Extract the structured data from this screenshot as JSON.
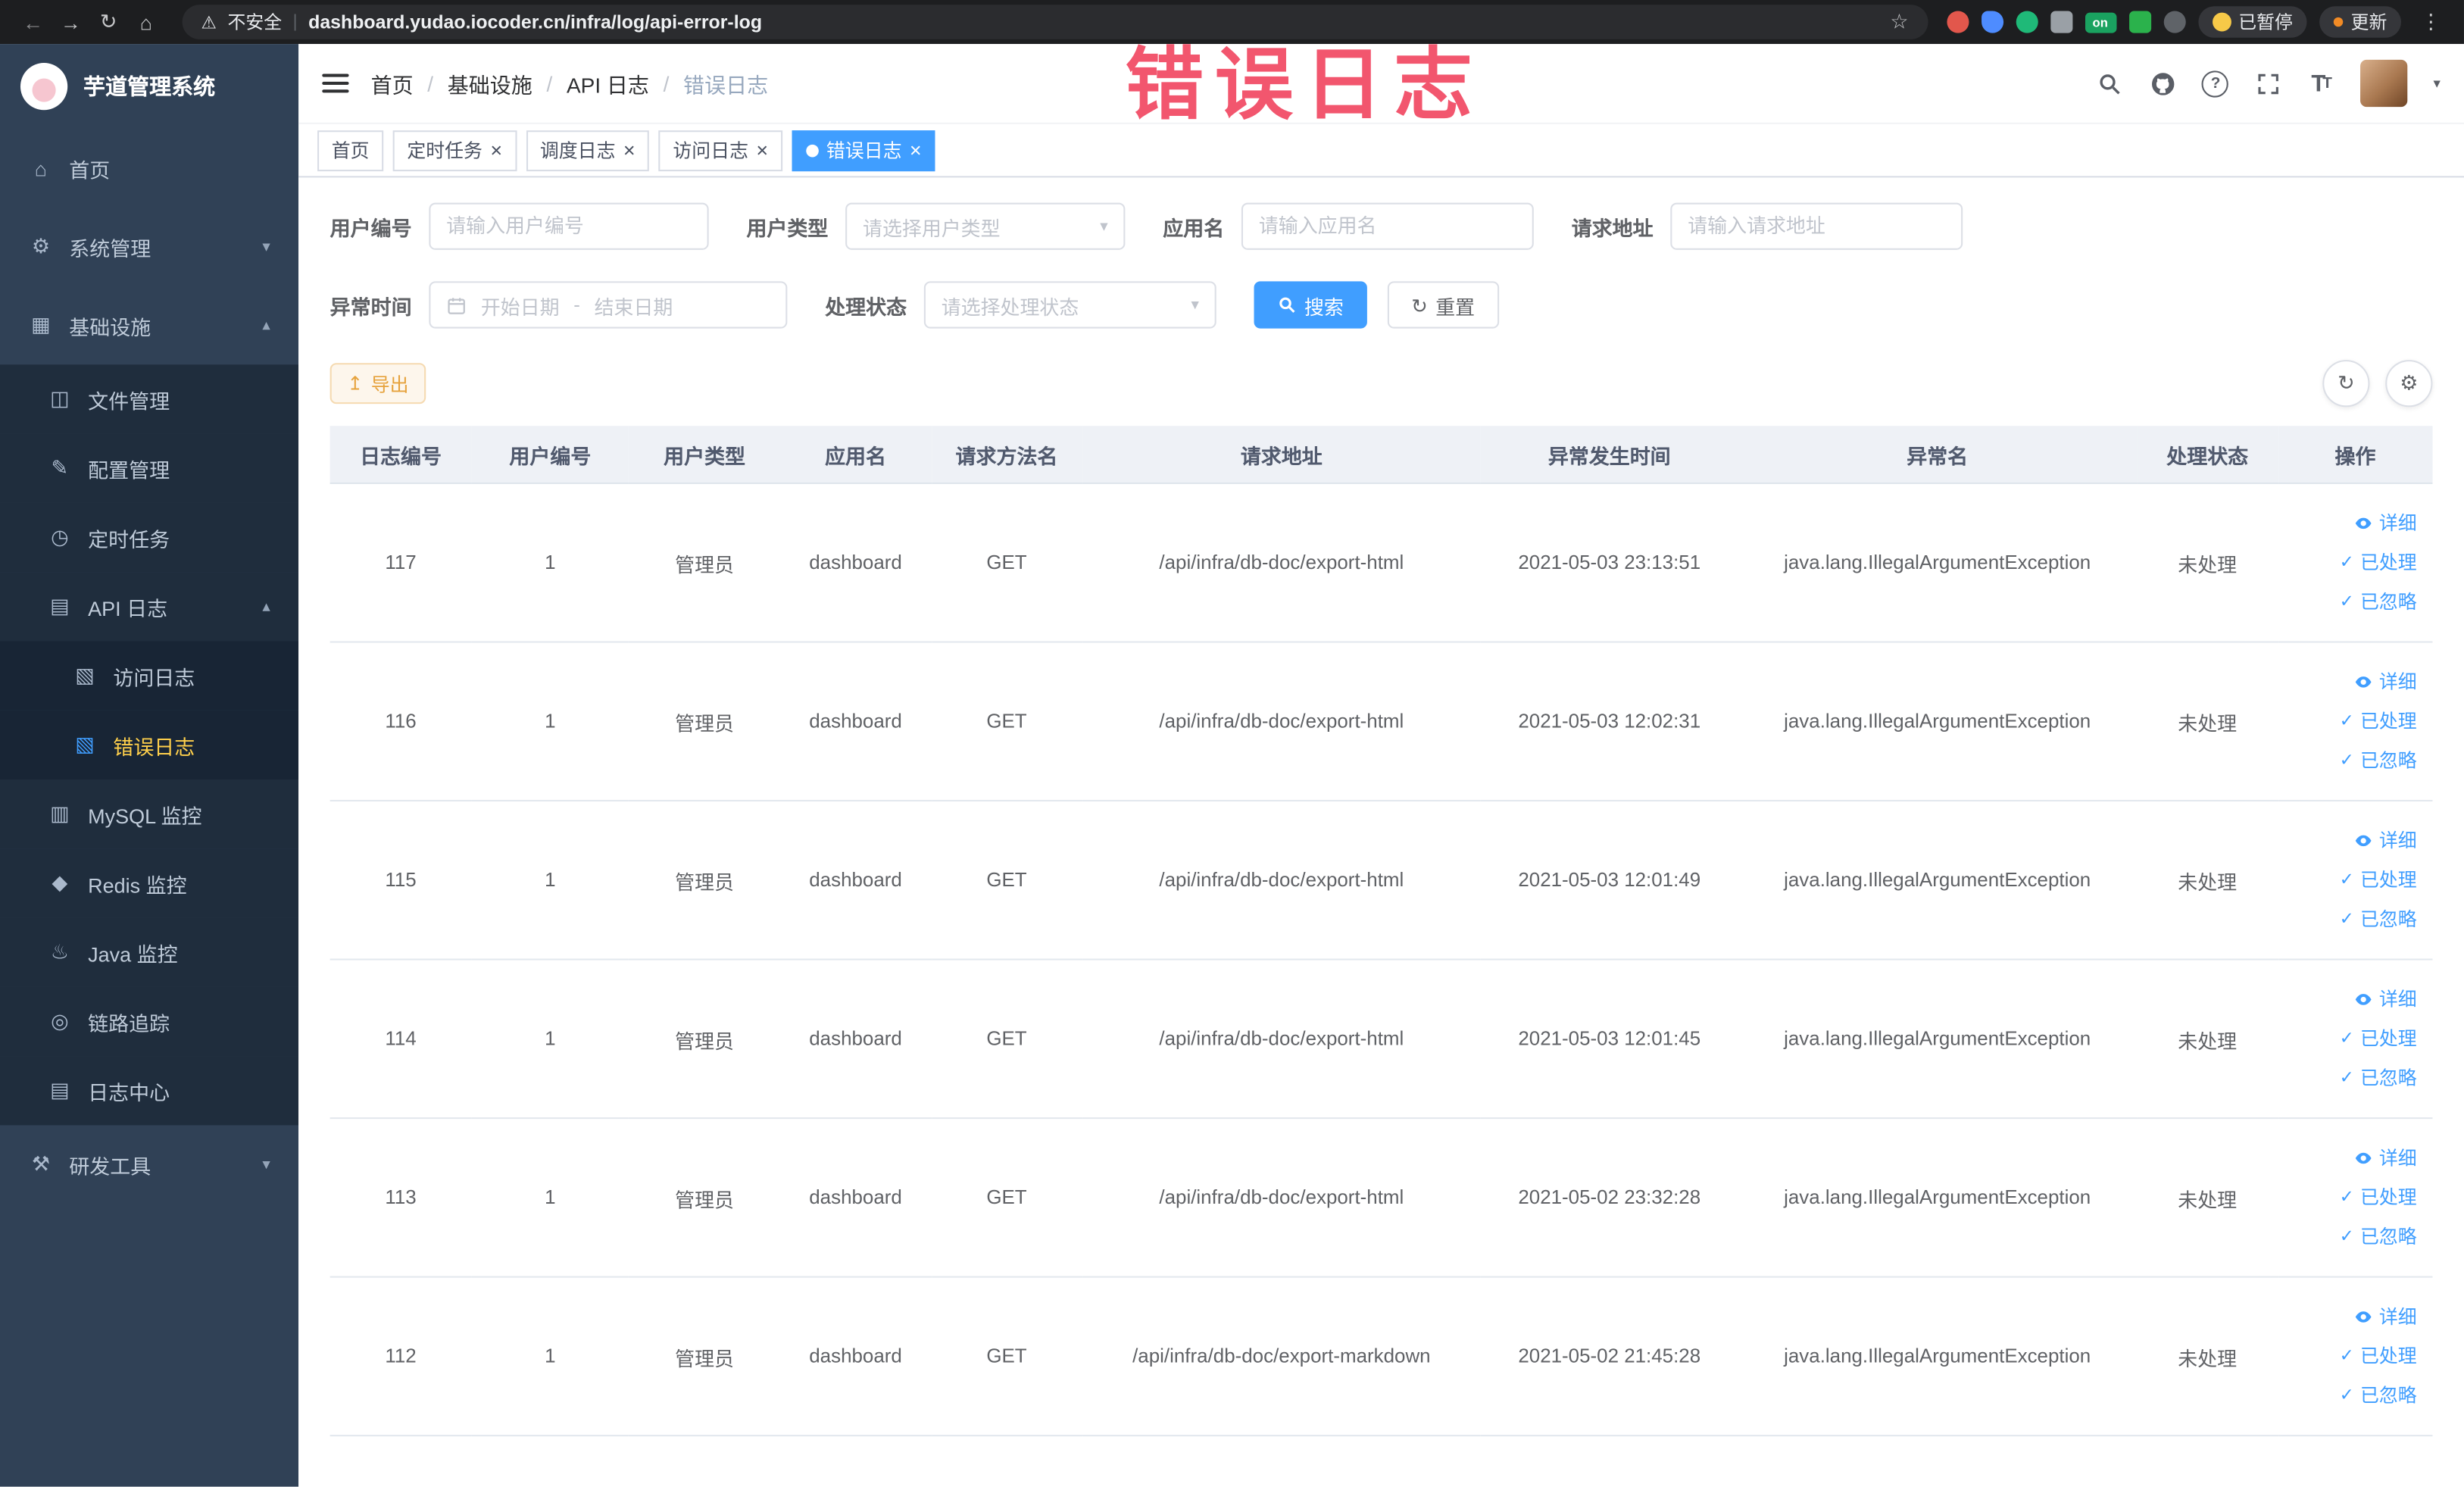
{
  "browser": {
    "security_label": "不安全",
    "separator": "|",
    "url": "dashboard.yudao.iocoder.cn/infra/log/api-error-log",
    "on_badge": "on",
    "paused_badge": "已暂停",
    "update_label": "更新"
  },
  "annotation": {
    "title": "错误日志"
  },
  "icons": {
    "back": "←",
    "forward": "→",
    "reload": "↻",
    "home": "⌂",
    "warning": "⚠",
    "star": "☆",
    "kebab": "⋮",
    "menu_home": "⌂",
    "menu_gear": "⚙",
    "menu_grid": "▦",
    "menu_folder": "◫",
    "menu_edit": "✎",
    "menu_clock": "◷",
    "menu_doc": "▤",
    "menu_page": "▧",
    "menu_db": "▥",
    "menu_diamond": "◆",
    "menu_java": "♨",
    "menu_trace": "◎",
    "menu_tools": "⚒",
    "chevron_down": "▾",
    "chevron_up": "▴",
    "close": "×",
    "check": "✓",
    "refresh": "↻",
    "gear": "⚙",
    "export": "↥",
    "question": "?",
    "text_size": "T",
    "caret": "▾"
  },
  "sidebar": {
    "logo_title": "芋道管理系统",
    "items": [
      {
        "label": "首页"
      },
      {
        "label": "系统管理"
      },
      {
        "label": "基础设施"
      },
      {
        "label": "文件管理"
      },
      {
        "label": "配置管理"
      },
      {
        "label": "定时任务"
      },
      {
        "label": "API 日志"
      },
      {
        "label": "访问日志"
      },
      {
        "label": "错误日志"
      },
      {
        "label": "MySQL 监控"
      },
      {
        "label": "Redis 监控"
      },
      {
        "label": "Java 监控"
      },
      {
        "label": "链路追踪"
      },
      {
        "label": "日志中心"
      },
      {
        "label": "研发工具"
      }
    ]
  },
  "header": {
    "breadcrumbs": [
      "首页",
      "基础设施",
      "API 日志",
      "错误日志"
    ],
    "breadcrumb_separator": "/"
  },
  "tabs": [
    {
      "label": "首页"
    },
    {
      "label": "定时任务"
    },
    {
      "label": "调度日志"
    },
    {
      "label": "访问日志"
    },
    {
      "label": "错误日志"
    }
  ],
  "filters": {
    "user_id": {
      "label": "用户编号",
      "placeholder": "请输入用户编号"
    },
    "user_type": {
      "label": "用户类型",
      "placeholder": "请选择用户类型"
    },
    "app_name": {
      "label": "应用名",
      "placeholder": "请输入应用名"
    },
    "request_url": {
      "label": "请求地址",
      "placeholder": "请输入请求地址"
    },
    "exception_time": {
      "label": "异常时间",
      "start_placeholder": "开始日期",
      "separator": "-",
      "end_placeholder": "结束日期"
    },
    "process_status": {
      "label": "处理状态",
      "placeholder": "请选择处理状态"
    },
    "search_button": "搜索",
    "reset_button": "重置"
  },
  "toolbar": {
    "export_button": "导出"
  },
  "table": {
    "columns": [
      "日志编号",
      "用户编号",
      "用户类型",
      "应用名",
      "请求方法名",
      "请求地址",
      "异常发生时间",
      "异常名",
      "处理状态",
      "操作"
    ],
    "row_actions": {
      "detail": "详细",
      "processed": "已处理",
      "ignored": "已忽略"
    },
    "rows": [
      {
        "id": "117",
        "user_id": "1",
        "user_type": "管理员",
        "app": "dashboard",
        "method": "GET",
        "url": "/api/infra/db-doc/export-html",
        "time": "2021-05-03 23:13:51",
        "exception": "java.lang.IllegalArgumentException",
        "status": "未处理"
      },
      {
        "id": "116",
        "user_id": "1",
        "user_type": "管理员",
        "app": "dashboard",
        "method": "GET",
        "url": "/api/infra/db-doc/export-html",
        "time": "2021-05-03 12:02:31",
        "exception": "java.lang.IllegalArgumentException",
        "status": "未处理"
      },
      {
        "id": "115",
        "user_id": "1",
        "user_type": "管理员",
        "app": "dashboard",
        "method": "GET",
        "url": "/api/infra/db-doc/export-html",
        "time": "2021-05-03 12:01:49",
        "exception": "java.lang.IllegalArgumentException",
        "status": "未处理"
      },
      {
        "id": "114",
        "user_id": "1",
        "user_type": "管理员",
        "app": "dashboard",
        "method": "GET",
        "url": "/api/infra/db-doc/export-html",
        "time": "2021-05-03 12:01:45",
        "exception": "java.lang.IllegalArgumentException",
        "status": "未处理"
      },
      {
        "id": "113",
        "user_id": "1",
        "user_type": "管理员",
        "app": "dashboard",
        "method": "GET",
        "url": "/api/infra/db-doc/export-html",
        "time": "2021-05-02 23:32:28",
        "exception": "java.lang.IllegalArgumentException",
        "status": "未处理"
      },
      {
        "id": "112",
        "user_id": "1",
        "user_type": "管理员",
        "app": "dashboard",
        "method": "GET",
        "url": "/api/infra/db-doc/export-markdown",
        "time": "2021-05-02 21:45:28",
        "exception": "java.lang.IllegalArgumentException",
        "status": "未处理"
      }
    ]
  },
  "colors": {
    "accent": "#409eff",
    "sidebar_bg": "#304156",
    "active_menu_text": "#ffd04b",
    "warning": "#e6a23c",
    "annotation": "#f2566e"
  }
}
